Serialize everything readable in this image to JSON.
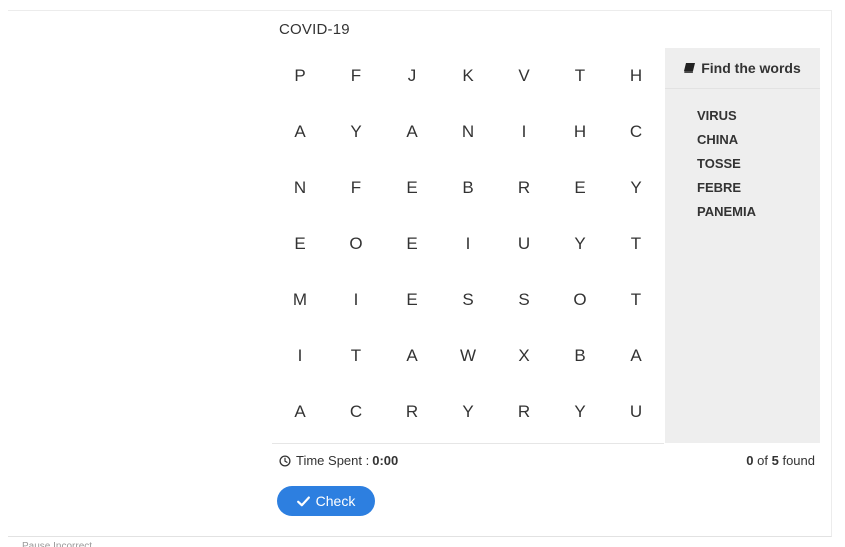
{
  "puzzle": {
    "title": "COVID-19",
    "grid": [
      [
        "P",
        "F",
        "J",
        "K",
        "V",
        "T",
        "H"
      ],
      [
        "A",
        "Y",
        "A",
        "N",
        "I",
        "H",
        "C"
      ],
      [
        "N",
        "F",
        "E",
        "B",
        "R",
        "E",
        "Y"
      ],
      [
        "E",
        "O",
        "E",
        "I",
        "U",
        "Y",
        "T"
      ],
      [
        "M",
        "I",
        "E",
        "S",
        "S",
        "O",
        "T"
      ],
      [
        "I",
        "T",
        "A",
        "W",
        "X",
        "B",
        "A"
      ],
      [
        "A",
        "C",
        "R",
        "Y",
        "R",
        "Y",
        "U"
      ]
    ]
  },
  "words_panel": {
    "header": "Find the words",
    "header_icon": "book-icon",
    "words": [
      "VIRUS",
      "CHINA",
      "TOSSE",
      "FEBRE",
      "PANEMIA"
    ]
  },
  "footer": {
    "time_label": "Time Spent :",
    "time_value": "0:00",
    "found_count": "0",
    "found_sep": " of ",
    "found_total": "5",
    "found_suffix": " found"
  },
  "actions": {
    "check_label": "Check"
  },
  "bottom_bar": {
    "text": "Pause    Incorrect"
  },
  "colors": {
    "accent": "#2d7fe0",
    "panel_bg": "#eeeeee"
  }
}
